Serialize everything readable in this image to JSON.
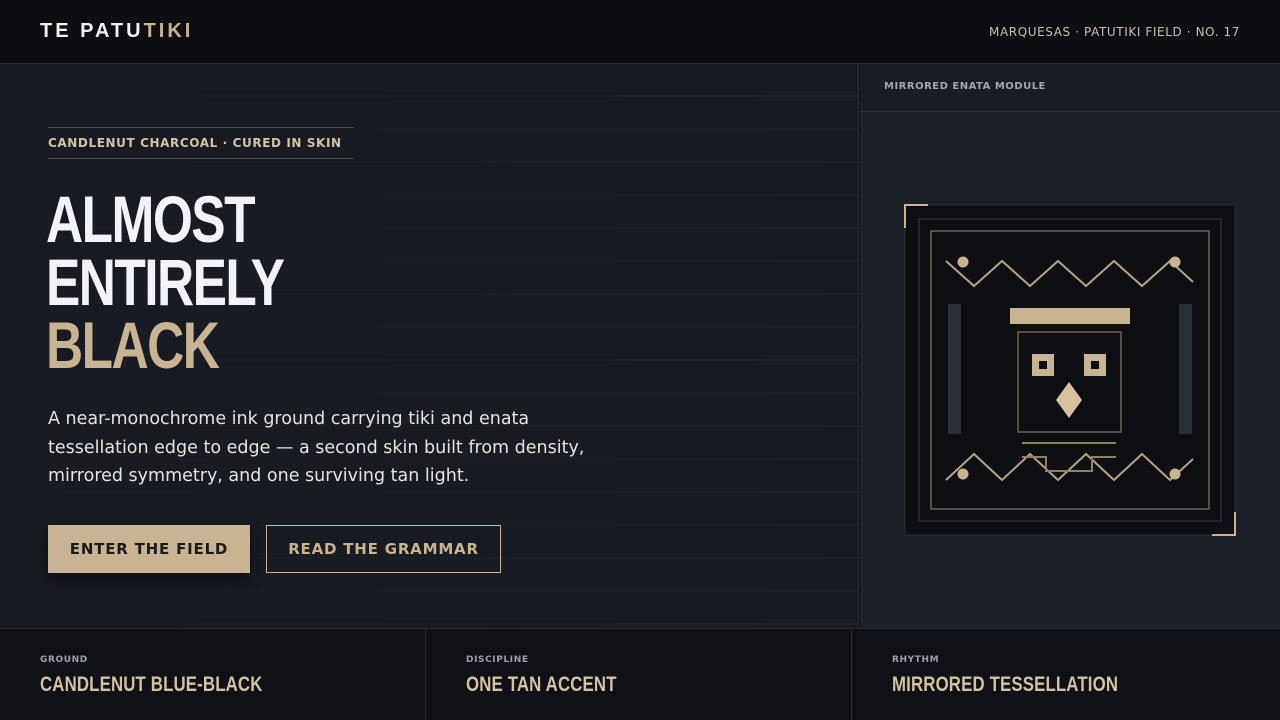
{
  "brand": {
    "part1": "TE PATU",
    "part2": "TIKI"
  },
  "meta": "MARQUESAS · PATUTIKI FIELD · NO. 17",
  "hero": {
    "eyebrow": "CANDLENUT CHARCOAL · CURED IN SKIN",
    "headline": [
      "ALMOST",
      "ENTIRELY",
      "BLACK"
    ],
    "lede": "A near-monochrome ink ground carrying tiki and enata tessellation edge to edge — a second skin built from density, mirrored symmetry, and one surviving tan light.",
    "primary_cta": "ENTER THE FIELD",
    "secondary_cta": "READ THE GRAMMAR"
  },
  "side": {
    "label": "MIRRORED ENATA MODULE"
  },
  "footer": [
    {
      "key": "GROUND",
      "value": "CANDLENUT BLUE-BLACK"
    },
    {
      "key": "DISCIPLINE",
      "value": "ONE TAN ACCENT"
    },
    {
      "key": "RHYTHM",
      "value": "MIRRORED TESSELLATION"
    }
  ],
  "colors": {
    "accent": "#c8b393",
    "ground": "#0e1015",
    "panel": "#181b21"
  }
}
